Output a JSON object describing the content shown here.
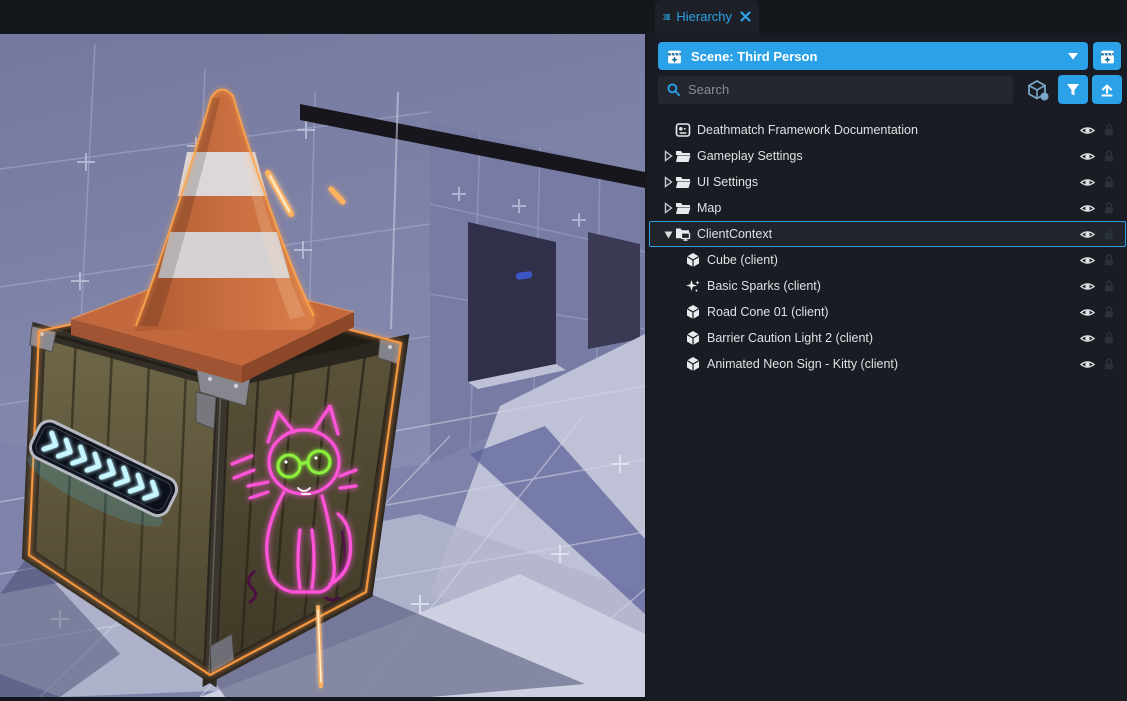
{
  "colors": {
    "accent_blue": "#2ba2e8",
    "panel_bg": "#191d23",
    "tabbar_bg": "#14171c",
    "selected_row_border": "#2f9fe1",
    "neon_cyan": "#c6f6ff",
    "neon_magenta": "#ff52da",
    "neon_green": "#8cf23c",
    "spark_orange": "#ffb35e"
  },
  "panel": {
    "tab": {
      "label": "Hierarchy",
      "icon": "hierarchy-list-icon",
      "close_icon": "close-icon"
    },
    "scene_selector": {
      "label": "Scene: Third Person",
      "icon": "scene-clapper-icon",
      "caret_icon": "chevron-down-icon"
    },
    "scene_button": {
      "icon": "scene-clapper-icon"
    },
    "search": {
      "placeholder": "Search",
      "icon": "search-icon"
    },
    "toolbar": {
      "cube_filter_icon": "cube-filter-icon",
      "filter_icon": "filter-funnel-icon",
      "collapse_icon": "collapse-up-icon"
    },
    "row_controls": {
      "visibility_icon": "eye-icon",
      "lock_icon": "lock-icon"
    }
  },
  "tree": {
    "rows": [
      {
        "label": "Deathmatch Framework Documentation",
        "icon": "documentation-icon",
        "depth": 0,
        "expander": "none",
        "selected": false
      },
      {
        "label": "Gameplay Settings",
        "icon": "folder-icon",
        "depth": 0,
        "expander": "collapsed",
        "selected": false
      },
      {
        "label": "UI Settings",
        "icon": "folder-icon",
        "depth": 0,
        "expander": "collapsed",
        "selected": false
      },
      {
        "label": "Map",
        "icon": "folder-icon",
        "depth": 0,
        "expander": "collapsed",
        "selected": false
      },
      {
        "label": "ClientContext",
        "icon": "client-context-folder-icon",
        "depth": 0,
        "expander": "expanded",
        "selected": true
      },
      {
        "label": "Cube (client)",
        "icon": "cube-icon",
        "depth": 1,
        "expander": "none",
        "selected": false
      },
      {
        "label": "Basic Sparks (client)",
        "icon": "sparks-icon",
        "depth": 1,
        "expander": "none",
        "selected": false
      },
      {
        "label": "Road Cone 01 (client)",
        "icon": "cube-icon",
        "depth": 1,
        "expander": "none",
        "selected": false
      },
      {
        "label": "Barrier Caution Light 2 (client)",
        "icon": "cube-icon",
        "depth": 1,
        "expander": "none",
        "selected": false
      },
      {
        "label": "Animated Neon Sign - Kitty (client)",
        "icon": "cube-icon",
        "depth": 1,
        "expander": "none",
        "selected": false
      }
    ]
  },
  "viewport": {
    "objects": [
      "traffic-cone",
      "wooden-crate",
      "neon-chevron-sign",
      "neon-kitty-sign",
      "spark-streaks"
    ]
  }
}
